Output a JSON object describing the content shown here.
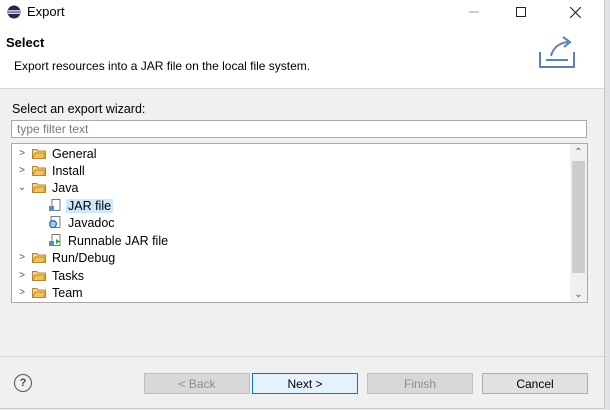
{
  "window": {
    "title": "Export"
  },
  "banner": {
    "title": "Select",
    "description": "Export resources into a JAR file on the local file system."
  },
  "wizard": {
    "label": "Select an export wizard:",
    "filter_placeholder": "type filter text",
    "filter_value": ""
  },
  "tree": {
    "items": [
      {
        "label": "General",
        "type": "folder",
        "expanded": false,
        "level": 0
      },
      {
        "label": "Install",
        "type": "folder",
        "expanded": false,
        "level": 0
      },
      {
        "label": "Java",
        "type": "folder",
        "expanded": true,
        "level": 0
      },
      {
        "label": "JAR file",
        "type": "jar-file",
        "level": 1,
        "selected": true
      },
      {
        "label": "Javadoc",
        "type": "javadoc",
        "level": 1
      },
      {
        "label": "Runnable JAR file",
        "type": "runnable-jar",
        "level": 1
      },
      {
        "label": "Run/Debug",
        "type": "folder",
        "expanded": false,
        "level": 0
      },
      {
        "label": "Tasks",
        "type": "folder",
        "expanded": false,
        "level": 0
      },
      {
        "label": "Team",
        "type": "folder",
        "expanded": false,
        "level": 0
      }
    ]
  },
  "buttons": {
    "back": "< Back",
    "next": "Next >",
    "finish": "Finish",
    "cancel": "Cancel"
  },
  "colors": {
    "selection": "#cce8ff",
    "folder": "#e8b94a",
    "primary_border": "#0078d7"
  }
}
